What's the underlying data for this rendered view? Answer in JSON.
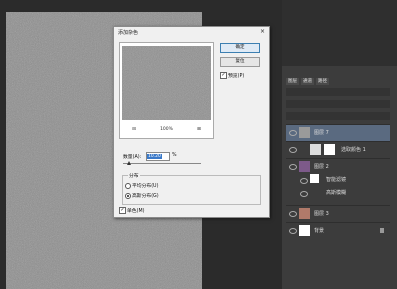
{
  "dialog": {
    "title": "添加杂色",
    "ok_label": "确定",
    "reset_label": "复位",
    "preview_label": "预览(P)",
    "preview_checked": true,
    "zoom_out": "⊟",
    "zoom_level": "100%",
    "zoom_in": "⊞",
    "amount_label": "数量(A):",
    "amount_value": "10.20",
    "amount_unit": "%",
    "distribution_label": "分布",
    "uniform_label": "平均分布(U)",
    "gaussian_label": "高斯分布(G)",
    "distribution_selected": "gaussian",
    "mono_label": "单色(M)",
    "mono_checked": true
  },
  "layers_panel": {
    "tabs": [
      "图层",
      "通道",
      "路径"
    ],
    "layers": [
      {
        "name": "图层 7",
        "selected": true
      },
      {
        "name": "选取颜色 1",
        "selected": false
      },
      {
        "name": "图层 2",
        "selected": false
      },
      {
        "name": "智能滤镜",
        "selected": false
      },
      {
        "name": "高斯模糊",
        "selected": false
      },
      {
        "name": "图层 3",
        "selected": false
      },
      {
        "name": "背景",
        "selected": false
      }
    ]
  },
  "colors": {
    "canvas": "#8a8a8a",
    "panel": "#3c3c3c",
    "selected_layer": "#5a6a80",
    "dialog_bg": "#f0f0f0"
  }
}
